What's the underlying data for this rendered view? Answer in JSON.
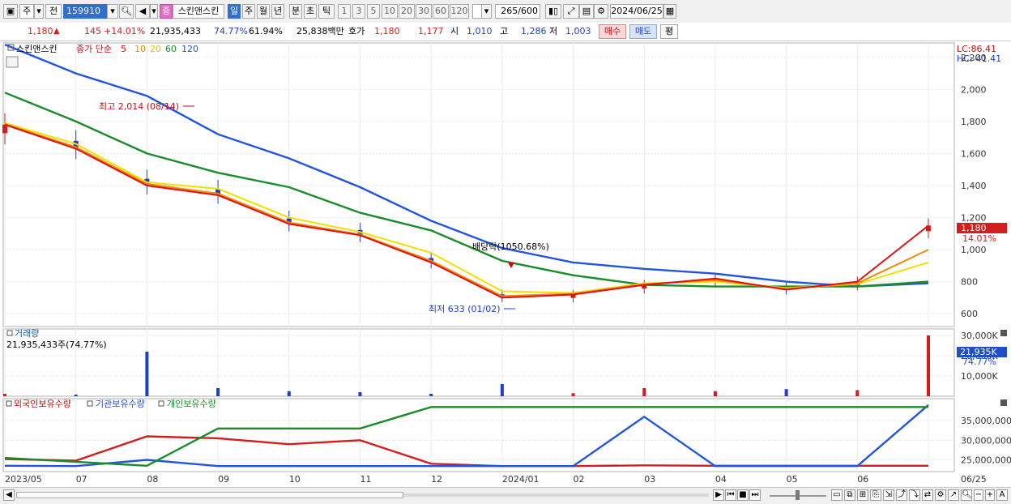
{
  "toolbar": {
    "market": "주",
    "prev": "전",
    "code": "159910",
    "name_badge": "증",
    "name": "스킨앤스킨",
    "periods": [
      "일",
      "주",
      "월",
      "년",
      "분",
      "초",
      "틱"
    ],
    "active_period": "일",
    "intervals": [
      "1",
      "3",
      "5",
      "10",
      "20",
      "30",
      "60",
      "120"
    ],
    "count": "265",
    "count_total": "/600",
    "date": "2024/06/25"
  },
  "quote": {
    "price": "1,180",
    "arrow": "▲",
    "change": "145",
    "change_pct": "+14.01%",
    "volume": "21,935,433",
    "vol_ratio": "74.77%",
    "rate2": "61.94%",
    "amount": "25,838백만",
    "ask_label": "호가",
    "ask": "1,180",
    "bid": "1,177",
    "open_label": "시",
    "open": "1,010",
    "high_label": "고",
    "high": "1,286",
    "low_label": "저",
    "low": "1,003",
    "buy_btn": "매수",
    "sell_btn": "매도",
    "eval_btn": "평"
  },
  "price_panel": {
    "legend_name": "스킨앤스킨",
    "legend_type": "종가 단순",
    "ma_labels": [
      "5",
      "10",
      "20",
      "60",
      "120"
    ],
    "ma_colors": [
      "#e01010",
      "#f08a00",
      "#f0e000",
      "#1a8c2a",
      "#2255dd"
    ],
    "lc": "LC:86.41",
    "hc": "HC:-41.41",
    "y_ticks": [
      "2,200",
      "2,000",
      "1,800",
      "1,600",
      "1,400",
      "1,200",
      "1,000",
      "800",
      "600"
    ],
    "current_price": "1,180",
    "current_pct": "14.01%",
    "high_note": "최고 2,014 (08/14)",
    "low_note": "최저 633 (01/02)",
    "dividend_note": "배당락(1050.68%)"
  },
  "volume_panel": {
    "title": "거래량",
    "value_text": "21,935,433주(74.77%)",
    "y_ticks": [
      "30,000K",
      "20,000K",
      "10,000K"
    ],
    "current": "21,935K",
    "current_pct": "74.77%"
  },
  "holding_panel": {
    "labels": [
      "외국인보유수량",
      "기관보유수량",
      "개인보유수량"
    ],
    "colors": [
      "#d21e1e",
      "#2255dd",
      "#1a8c2a"
    ],
    "y_ticks": [
      "35,000,000",
      "30,000,000",
      "25,000,000"
    ]
  },
  "x_axis": [
    "2023/05",
    "07",
    "08",
    "09",
    "10",
    "11",
    "12",
    "2024/01",
    "02",
    "03",
    "04",
    "05",
    "06",
    "06/25"
  ],
  "chart_data": {
    "type": "line",
    "title": "",
    "xlabel": "",
    "ylabel": "",
    "ylim": [
      520,
      2290
    ],
    "x": [
      "2023/05",
      "07",
      "08",
      "09",
      "10",
      "11",
      "12",
      "2024/01",
      "02",
      "03",
      "04",
      "05",
      "06",
      "06/25"
    ],
    "series": [
      {
        "name": "5",
        "values": [
          1780,
          1630,
          1400,
          1340,
          1160,
          1090,
          920,
          700,
          720,
          780,
          820,
          750,
          800,
          1150
        ]
      },
      {
        "name": "10",
        "values": [
          1785,
          1640,
          1410,
          1350,
          1170,
          1095,
          930,
          710,
          725,
          785,
          810,
          755,
          790,
          1000
        ]
      },
      {
        "name": "20",
        "values": [
          1790,
          1660,
          1420,
          1380,
          1200,
          1110,
          980,
          740,
          730,
          790,
          800,
          760,
          785,
          920
        ]
      },
      {
        "name": "60",
        "values": [
          1980,
          1800,
          1600,
          1480,
          1390,
          1230,
          1120,
          930,
          840,
          780,
          770,
          770,
          770,
          800
        ]
      },
      {
        "name": "120",
        "values": [
          2280,
          2100,
          1960,
          1720,
          1570,
          1390,
          1180,
          1010,
          920,
          880,
          850,
          800,
          770,
          790
        ]
      }
    ],
    "volume_k": [
      1200,
      800,
      22000,
      4000,
      2500,
      2000,
      1200,
      6000,
      1500,
      4000,
      2500,
      3500,
      3000,
      30000
    ],
    "holdings": [
      {
        "name": "외국인보유수량",
        "values": [
          25200000,
          24800000,
          31000000,
          30500000,
          29000000,
          30000000,
          24000000,
          23400000,
          23400000,
          23600000,
          23500000,
          23500000,
          23500000,
          23500000
        ]
      },
      {
        "name": "기관보유수량",
        "values": [
          23500000,
          23400000,
          25000000,
          23400000,
          23400000,
          23400000,
          23400000,
          23400000,
          23400000,
          36000000,
          23400000,
          23400000,
          23400000,
          39000000
        ]
      },
      {
        "name": "개인보유수량",
        "values": [
          25500000,
          24500000,
          23500000,
          33000000,
          33000000,
          33000000,
          38500000,
          38500000,
          38500000,
          38500000,
          38500000,
          38500000,
          38500000,
          38500000
        ]
      }
    ]
  }
}
